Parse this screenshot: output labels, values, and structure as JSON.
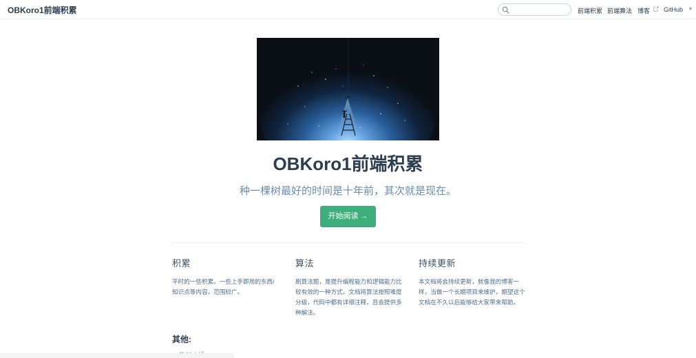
{
  "navbar": {
    "brand": "OBKoro1前端积累",
    "search": {
      "value": "",
      "placeholder": ""
    },
    "links": [
      {
        "label": "前端积累"
      },
      {
        "label": "前端算法"
      },
      {
        "label": "博客",
        "external": true
      },
      {
        "label": "GitHub",
        "dropdown": true
      }
    ]
  },
  "hero": {
    "image": "night-sky-ladder-illustration",
    "title": "OBKoro1前端积累",
    "description": "种一棵树最好的时间是十年前，其次就是现在。",
    "action": "开始阅读 →"
  },
  "features": [
    {
      "title": "积累",
      "details": "平时的一些积累。一些上手即用的东西/知识点等内容，范围较广。"
    },
    {
      "title": "算法",
      "details": "刷算法题，是提升编程能力和逻辑能力比较有效的一种方式。文档将算法按照难度分级，代码中都有详细注释，且会提供多种解法。"
    },
    {
      "title": "持续更新",
      "details": "本文档将会持续更新，就像我的博客一样，当做一个长期项目来维护，期望这个文档在不久以后能够给大家带来帮助。"
    }
  ],
  "other": {
    "title": "其他:",
    "links": [
      {
        "label": "GitHub",
        "external": true
      }
    ]
  },
  "colors": {
    "accent": "#3eaf7c",
    "text": "#2c3e50",
    "muted": "#6a8bad"
  }
}
